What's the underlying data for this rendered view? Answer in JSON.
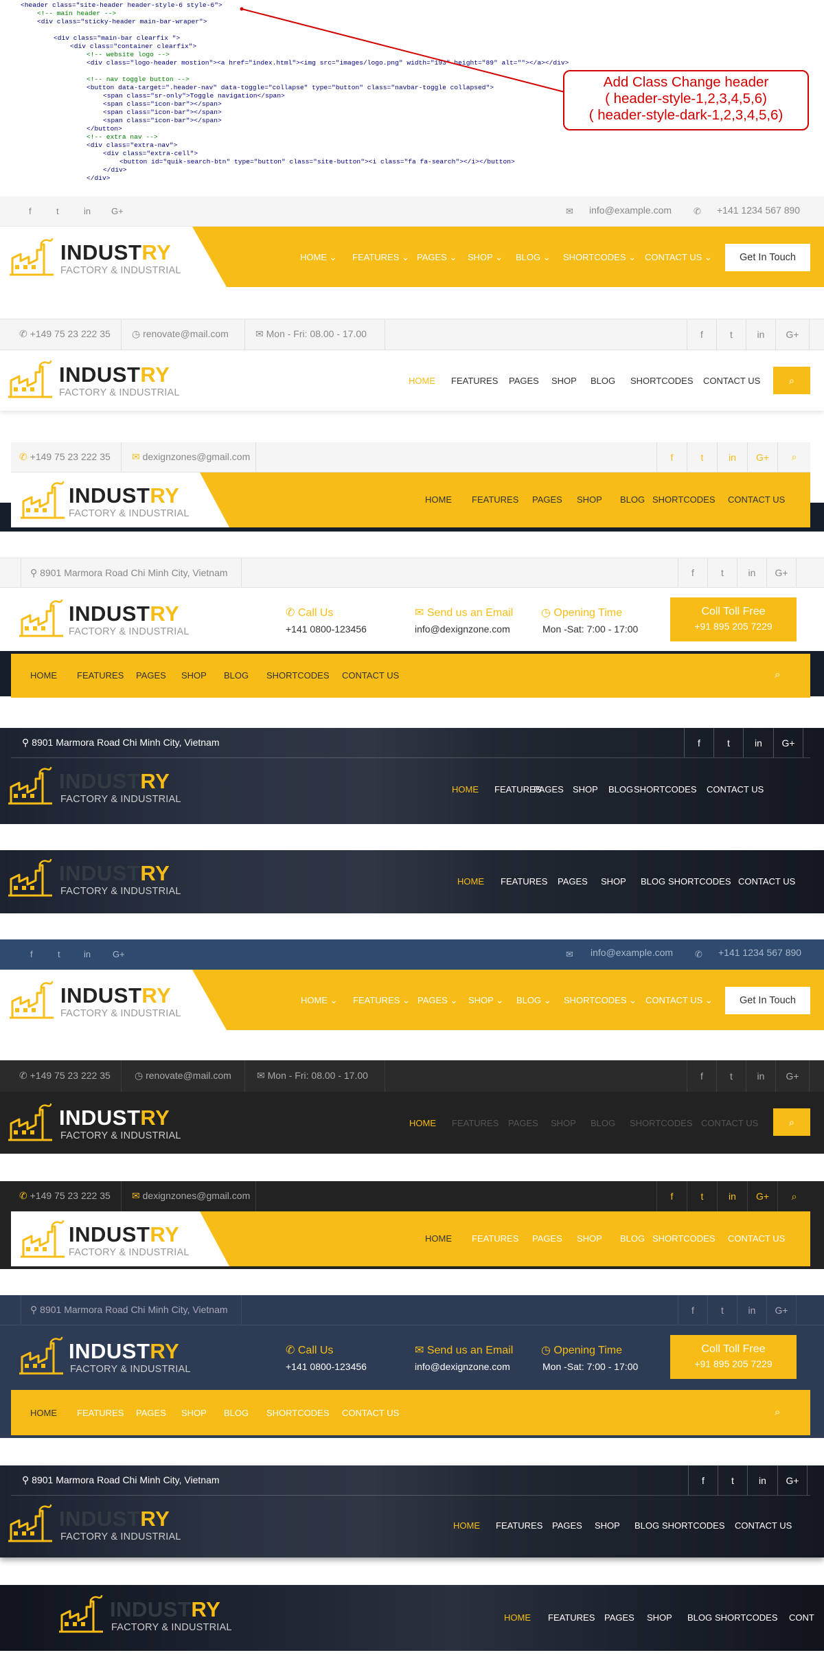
{
  "code": {
    "lines": [
      {
        "i": 0,
        "t": "<header class=\"site-header header-style-6 style-6\">"
      },
      {
        "i": 1,
        "t": "<!-- main header -->"
      },
      {
        "i": 1,
        "t": "<div class=\"sticky-header main-bar-wraper\">"
      },
      {
        "i": 2,
        "t": ""
      },
      {
        "i": 2,
        "t": "<div class=\"main-bar clearfix \">"
      },
      {
        "i": 3,
        "t": "<div class=\"container clearfix\">"
      },
      {
        "i": 4,
        "t": "<!-- website logo -->"
      },
      {
        "i": 4,
        "t": "<div class=\"logo-header mostion\"><a href=\"index.html\"><img src=\"images/logo.png\" width=\"193\" height=\"89\" alt=\"\"></a></div>"
      },
      {
        "i": 4,
        "t": ""
      },
      {
        "i": 4,
        "t": "<!-- nav toggle button -->"
      },
      {
        "i": 4,
        "t": "<button data-target=\".header-nav\" data-toggle=\"collapse\" type=\"button\" class=\"navbar-toggle collapsed\">"
      },
      {
        "i": 5,
        "t": "<span class=\"sr-only\">Toggle navigation</span>"
      },
      {
        "i": 5,
        "t": "<span class=\"icon-bar\"></span>"
      },
      {
        "i": 5,
        "t": "<span class=\"icon-bar\"></span>"
      },
      {
        "i": 5,
        "t": "<span class=\"icon-bar\"></span>"
      },
      {
        "i": 4,
        "t": "</button>"
      },
      {
        "i": 4,
        "t": "<!-- extra nav -->"
      },
      {
        "i": 4,
        "t": "<div class=\"extra-nav\">"
      },
      {
        "i": 5,
        "t": "<div class=\"extra-cell\">"
      },
      {
        "i": 6,
        "t": "<button id=\"quik-search-btn\" type=\"button\" class=\"site-button\"><i class=\"fa fa-search\"></i></button>"
      },
      {
        "i": 5,
        "t": "</div>"
      },
      {
        "i": 4,
        "t": "</div>"
      }
    ],
    "callout": [
      "Add Class Change header",
      "( header-style-1,2,3,4,5,6)",
      "( header-style-dark-1,2,3,4,5,6)"
    ]
  },
  "brand": {
    "name_a": "INDUST",
    "name_b": "RY",
    "tagline": "FACTORY & INDUSTRIAL"
  },
  "contact": {
    "email": "info@example.com",
    "phone": "+141 1234 567 890",
    "phone2": "+149 75 23 222 35",
    "email2": "renovate@mail.com",
    "hours": "Mon - Fri: 08.00 - 17.00",
    "email3": "dexignzones@gmail.com",
    "address": "8901 Marmora Road Chi Minh City, Vietnam",
    "call_label": "Call Us",
    "call_value": "+141 0800-123456",
    "send_label": "Send us an Email",
    "send_value": "info@dexignzone.com",
    "open_label": "Opening Time",
    "open_value": "Mon -Sat: 7:00 - 17:00",
    "toll_label": "Coll Toll Free",
    "toll_value": "+91 895 205 7229"
  },
  "nav": {
    "home": "HOME",
    "features": "FEATURES",
    "pages": "PAGES",
    "shop": "SHOP",
    "blog": "BLOG",
    "shortcodes": "SHORTCODES",
    "contact": "CONTACT US",
    "contact_cut": "CONT"
  },
  "cta": "Get In Touch",
  "colors": {
    "accent": "#f7bd16",
    "dark": "#222222",
    "navy": "#2d3b55",
    "blue_bar": "#2e4a6e"
  },
  "icons": [
    "facebook-icon",
    "twitter-icon",
    "linkedin-icon",
    "google-plus-icon",
    "search-icon",
    "envelope-icon",
    "phone-icon",
    "clock-icon",
    "map-marker-icon",
    "chevron-down-icon"
  ]
}
